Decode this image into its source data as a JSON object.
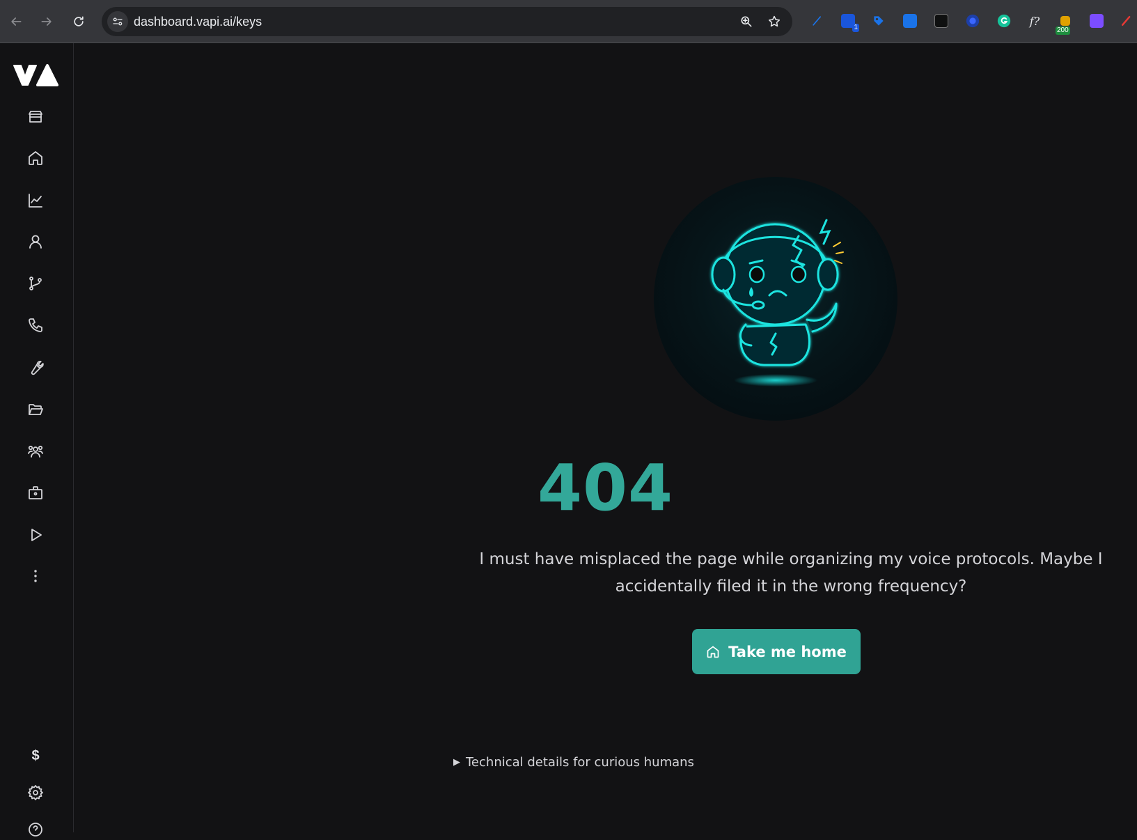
{
  "browser": {
    "url": "dashboard.vapi.ai/keys",
    "extension_badges": {
      "ext2": "1",
      "ext9": "200"
    },
    "extension_fx_label": "f?"
  },
  "sidebar": {
    "icons": [
      "store-icon",
      "home-icon",
      "chart-line-icon",
      "user-icon",
      "git-branch-icon",
      "phone-icon",
      "wrench-icon",
      "folder-open-icon",
      "users-icon",
      "briefcase-lock-icon",
      "play-icon",
      "more-vertical-icon"
    ],
    "billing_symbol": "$",
    "bottom_icons": [
      "gear-icon",
      "help-icon"
    ]
  },
  "error": {
    "code": "404",
    "message": "I must have misplaced the page while organizing my voice protocols. Maybe I accidentally filed it in the wrong frequency?",
    "button_label": "Take me home",
    "details_label": "Technical details for curious humans"
  },
  "colors": {
    "accent": "#30a394",
    "code_color": "#33a899",
    "background": "#121214",
    "mascot_glow": "#1de4e0"
  }
}
